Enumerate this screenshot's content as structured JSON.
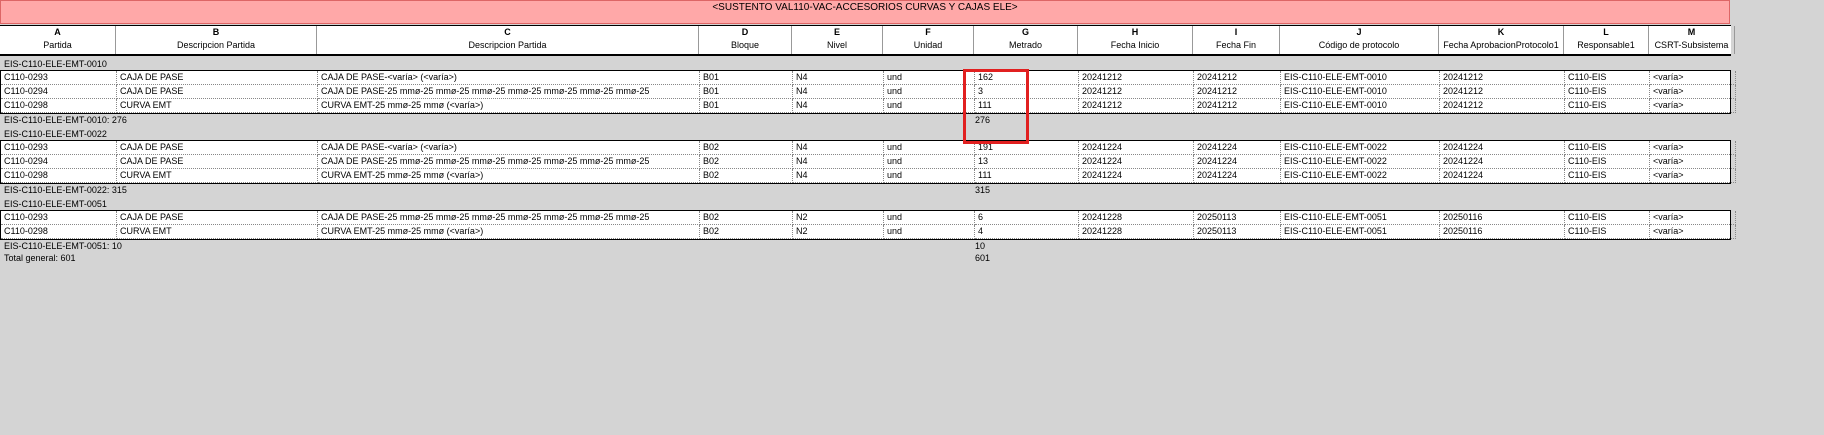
{
  "title": "<SUSTENTO VAL110-VAC-ACCESORIOS CURVAS Y CAJAS ELE>",
  "column_letters": [
    "A",
    "B",
    "C",
    "D",
    "E",
    "F",
    "G",
    "H",
    "I",
    "J",
    "K",
    "L",
    "M"
  ],
  "column_headers": [
    "Partida",
    "Descripcion Partida",
    "Descripcion Partida",
    "Bloque",
    "Nivel",
    "Unidad",
    "Metrado",
    "Fecha Inicio",
    "Fecha Fin",
    "Código de protocolo",
    "Fecha AprobacionProtocolo1",
    "Responsable1",
    "CSRT-Subsistema"
  ],
  "groups": [
    {
      "label": "EIS-C110-ELE-EMT-0010",
      "rows": [
        [
          "C110-0293",
          "CAJA DE PASE",
          "CAJA DE PASE-<varía> (<varía>)",
          "B01",
          "N4",
          "und",
          "162",
          "20241212",
          "20241212",
          "EIS-C110-ELE-EMT-0010",
          "20241212",
          "C110-EIS",
          "<varía>"
        ],
        [
          "C110-0294",
          "CAJA DE PASE",
          "CAJA DE PASE-25 mmø-25 mmø-25 mmø-25 mmø-25 mmø-25 mmø-25 mmø-25",
          "B01",
          "N4",
          "und",
          "3",
          "20241212",
          "20241212",
          "EIS-C110-ELE-EMT-0010",
          "20241212",
          "C110-EIS",
          "<varía>"
        ],
        [
          "C110-0298",
          "CURVA EMT",
          "CURVA EMT-25 mmø-25 mmø (<varía>)",
          "B01",
          "N4",
          "und",
          "111",
          "20241212",
          "20241212",
          "EIS-C110-ELE-EMT-0010",
          "20241212",
          "C110-EIS",
          "<varía>"
        ]
      ],
      "subtotal_label": "EIS-C110-ELE-EMT-0010: 276",
      "subtotal_value": "276"
    },
    {
      "label": "EIS-C110-ELE-EMT-0022",
      "rows": [
        [
          "C110-0293",
          "CAJA DE PASE",
          "CAJA DE PASE-<varía> (<varía>)",
          "B02",
          "N4",
          "und",
          "191",
          "20241224",
          "20241224",
          "EIS-C110-ELE-EMT-0022",
          "20241224",
          "C110-EIS",
          "<varía>"
        ],
        [
          "C110-0294",
          "CAJA DE PASE",
          "CAJA DE PASE-25 mmø-25 mmø-25 mmø-25 mmø-25 mmø-25 mmø-25 mmø-25",
          "B02",
          "N4",
          "und",
          "13",
          "20241224",
          "20241224",
          "EIS-C110-ELE-EMT-0022",
          "20241224",
          "C110-EIS",
          "<varía>"
        ],
        [
          "C110-0298",
          "CURVA EMT",
          "CURVA EMT-25 mmø-25 mmø (<varía>)",
          "B02",
          "N4",
          "und",
          "111",
          "20241224",
          "20241224",
          "EIS-C110-ELE-EMT-0022",
          "20241224",
          "C110-EIS",
          "<varía>"
        ]
      ],
      "subtotal_label": "EIS-C110-ELE-EMT-0022: 315",
      "subtotal_value": "315"
    },
    {
      "label": "EIS-C110-ELE-EMT-0051",
      "rows": [
        [
          "C110-0293",
          "CAJA DE PASE",
          "CAJA DE PASE-25 mmø-25 mmø-25 mmø-25 mmø-25 mmø-25 mmø-25 mmø-25",
          "B02",
          "N2",
          "und",
          "6",
          "20241228",
          "20250113",
          "EIS-C110-ELE-EMT-0051",
          "20250116",
          "C110-EIS",
          "<varía>"
        ],
        [
          "C110-0298",
          "CURVA EMT",
          "CURVA EMT-25 mmø-25 mmø (<varía>)",
          "B02",
          "N2",
          "und",
          "4",
          "20241228",
          "20250113",
          "EIS-C110-ELE-EMT-0051",
          "20250116",
          "C110-EIS",
          "<varía>"
        ]
      ],
      "subtotal_label": "EIS-C110-ELE-EMT-0051: 10",
      "subtotal_value": "10"
    }
  ],
  "total_label": "Total general: 601",
  "total_value": "601",
  "colors": {
    "title_bg": "#ffa8a8",
    "highlight": "#e12020",
    "canvas": "#d4d4d4"
  }
}
